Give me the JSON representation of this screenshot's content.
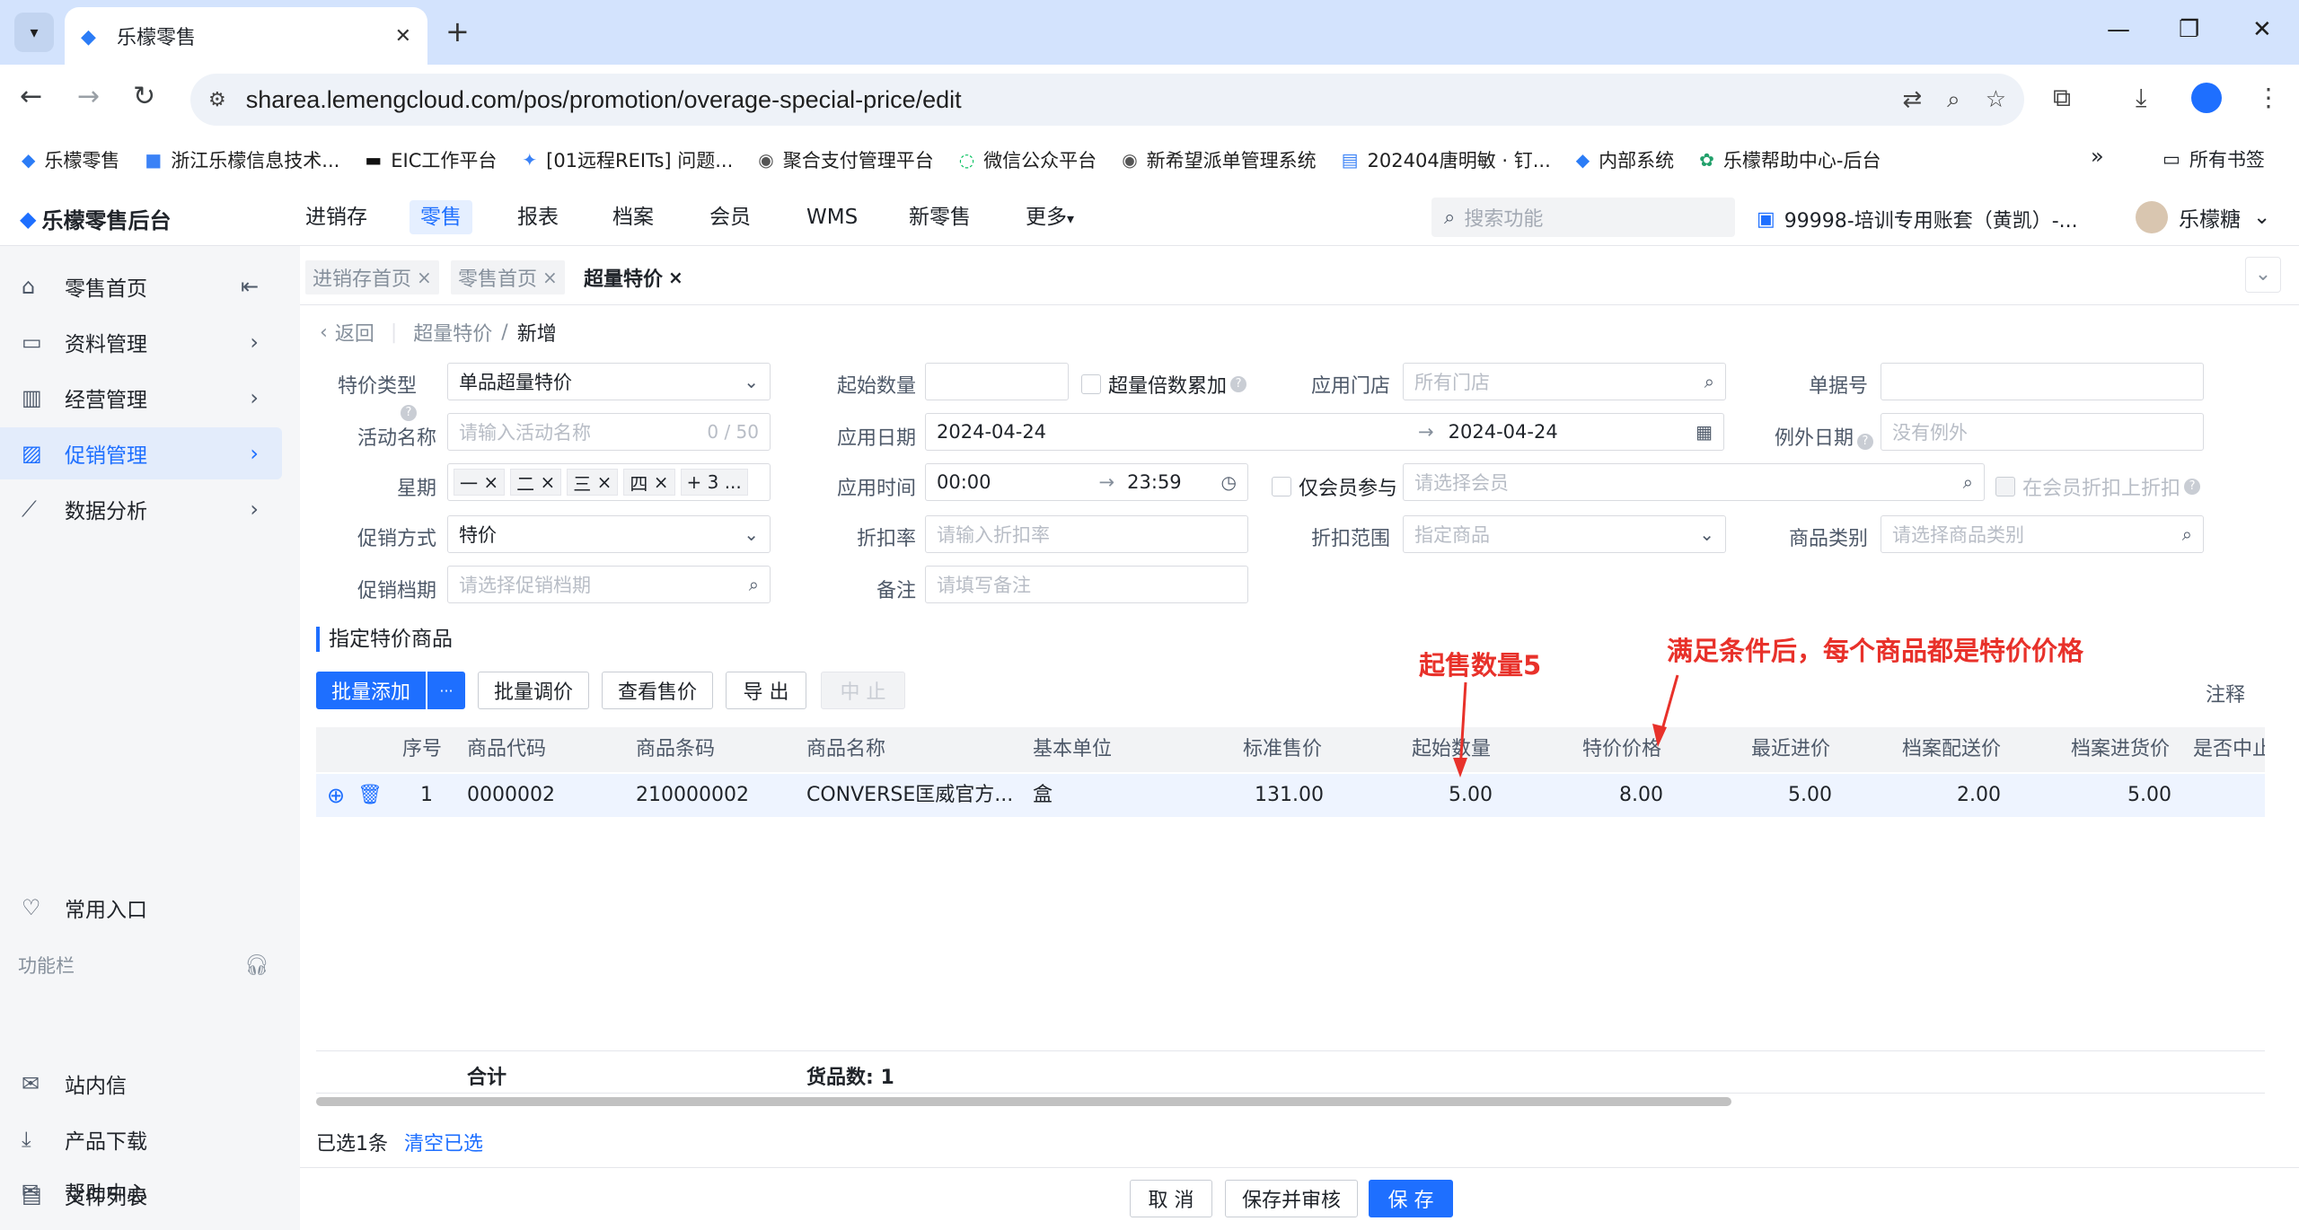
{
  "browser": {
    "tab_title": "乐檬零售",
    "url": "sharea.lemengcloud.com/pos/promotion/overage-special-price/edit",
    "bookmarks": [
      "乐檬零售",
      "浙江乐檬信息技术...",
      "EIC工作平台",
      "[01远程REITs] 问题...",
      "聚合支付管理平台",
      "微信公众平台",
      "新希望派单管理系统",
      "202404唐明敏 · 钉...",
      "内部系统",
      "乐檬帮助中心-后台"
    ],
    "all_bookmarks": "所有书签"
  },
  "app": {
    "logo": "乐檬零售后台",
    "nav": [
      "进销存",
      "零售",
      "报表",
      "档案",
      "会员",
      "WMS",
      "新零售",
      "更多"
    ],
    "search_placeholder": "搜索功能",
    "account": "99998-培训专用账套（黄凯）-...",
    "user": "乐檬糖"
  },
  "sidebar": {
    "items": [
      "零售首页",
      "资料管理",
      "经营管理",
      "促销管理",
      "数据分析"
    ],
    "common": "常用入口",
    "funcbar": "功能栏",
    "bottom": [
      "站内信",
      "产品下载",
      "文件列表",
      "帮助中心"
    ]
  },
  "page_tabs": [
    "进销存首页",
    "零售首页",
    "超量特价"
  ],
  "breadcrumb": {
    "back": "返回",
    "parent": "超量特价",
    "sep": "/",
    "current": "新增"
  },
  "form": {
    "type_label": "特价类型",
    "type_value": "单品超量特价",
    "name_label": "活动名称",
    "name_placeholder": "请输入活动名称",
    "name_count": "0 / 50",
    "week_label": "星期",
    "week_tags": [
      "一",
      "二",
      "三",
      "四"
    ],
    "week_more": "+ 3 ...",
    "method_label": "促销方式",
    "method_value": "特价",
    "period_label": "促销档期",
    "period_placeholder": "请选择促销档期",
    "start_qty_label": "起始数量",
    "multiple_label": "超量倍数累加",
    "date_label": "应用日期",
    "date_from": "2024-04-24",
    "date_to": "2024-04-24",
    "time_label": "应用时间",
    "time_from": "00:00",
    "time_to": "23:59",
    "discount_label": "折扣率",
    "discount_placeholder": "请输入折扣率",
    "remark_label": "备注",
    "remark_placeholder": "请填写备注",
    "store_label": "应用门店",
    "store_placeholder": "所有门店",
    "member_only_label": "仅会员参与",
    "member_placeholder": "请选择会员",
    "scope_label": "折扣范围",
    "scope_placeholder": "指定商品",
    "doc_label": "单据号",
    "except_label": "例外日期",
    "except_placeholder": "没有例外",
    "member_discount_label": "在会员折扣上折扣",
    "category_label": "商品类别",
    "category_placeholder": "请选择商品类别"
  },
  "section_title": "指定特价商品",
  "buttons": {
    "batch_add": "批量添加",
    "more": "···",
    "batch_price": "批量调价",
    "view_price": "查看售价",
    "export": "导 出",
    "stop": "中 止",
    "note": "注释"
  },
  "table": {
    "headers": [
      "序号",
      "商品代码",
      "商品条码",
      "商品名称",
      "基本单位",
      "标准售价",
      "起始数量",
      "特价价格",
      "最近进价",
      "档案配送价",
      "档案进货价",
      "是否中止"
    ],
    "rows": [
      [
        "1",
        "0000002",
        "210000002",
        "CONVERSE匡威官方...",
        "盒",
        "131.00",
        "5.00",
        "8.00",
        "5.00",
        "2.00",
        "5.00",
        ""
      ]
    ],
    "total_label": "合计",
    "count_label": "货品数: 1"
  },
  "selection": {
    "selected": "已选1条",
    "clear": "清空已选"
  },
  "annotations": {
    "qty": "起售数量5",
    "price": "满足条件后，每个商品都是特价价格"
  },
  "footer": {
    "cancel": "取 消",
    "save_review": "保存并审核",
    "save": "保 存"
  },
  "colors": {
    "primary": "#1e6fff",
    "annotation": "#e8312a"
  }
}
